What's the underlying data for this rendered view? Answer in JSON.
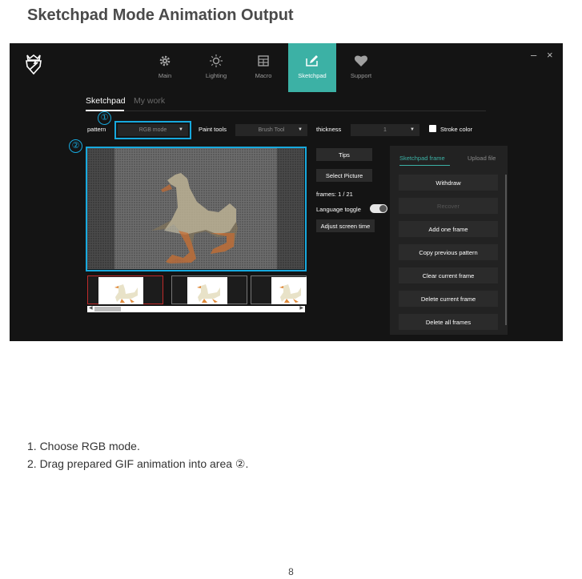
{
  "doc": {
    "title": "Sketchpad Mode Animation Output",
    "instructions": [
      "1. Choose RGB mode.",
      "2. Drag prepared GIF animation into area ②."
    ],
    "page_number": "8"
  },
  "app": {
    "nav": [
      {
        "label": "Main",
        "icon": "gear-icon"
      },
      {
        "label": "Lighting",
        "icon": "bulb-icon"
      },
      {
        "label": "Macro",
        "icon": "macro-icon"
      },
      {
        "label": "Sketchpad",
        "icon": "sketchpad-icon",
        "active": true
      },
      {
        "label": "Support",
        "icon": "heart-icon"
      }
    ],
    "window": {
      "minimize": "–",
      "close": "×"
    },
    "subtabs": {
      "sketchpad": "Sketchpad",
      "mywork": "My work"
    },
    "toolbar": {
      "pattern_label": "pattern",
      "pattern_value": "RGB mode",
      "paint_tools_label": "Paint tools",
      "paint_tools_value": "Brush Tool",
      "thickness_label": "thickness",
      "thickness_value": "1",
      "stroke_color_label": "Stroke color"
    },
    "markers": {
      "one": "①",
      "two": "②"
    },
    "middle": {
      "tips": "Tips",
      "select_picture": "Select Picture",
      "frames": "frames: 1 / 21",
      "language_toggle": "Language toggle",
      "adjust_time": "Adjust screen time"
    },
    "panel": {
      "tab_frame": "Sketchpad frame",
      "tab_upload": "Upload file",
      "buttons": {
        "withdraw": "Withdraw",
        "recover": "Recover",
        "add_one": "Add one frame",
        "copy_prev": "Copy previous pattern",
        "clear_current": "Clear current frame",
        "delete_current": "Delete current frame",
        "delete_all": "Delete all frames"
      }
    },
    "colors": {
      "accent": "#3cb1a5",
      "highlight": "#17a9de",
      "background": "#141414"
    }
  }
}
